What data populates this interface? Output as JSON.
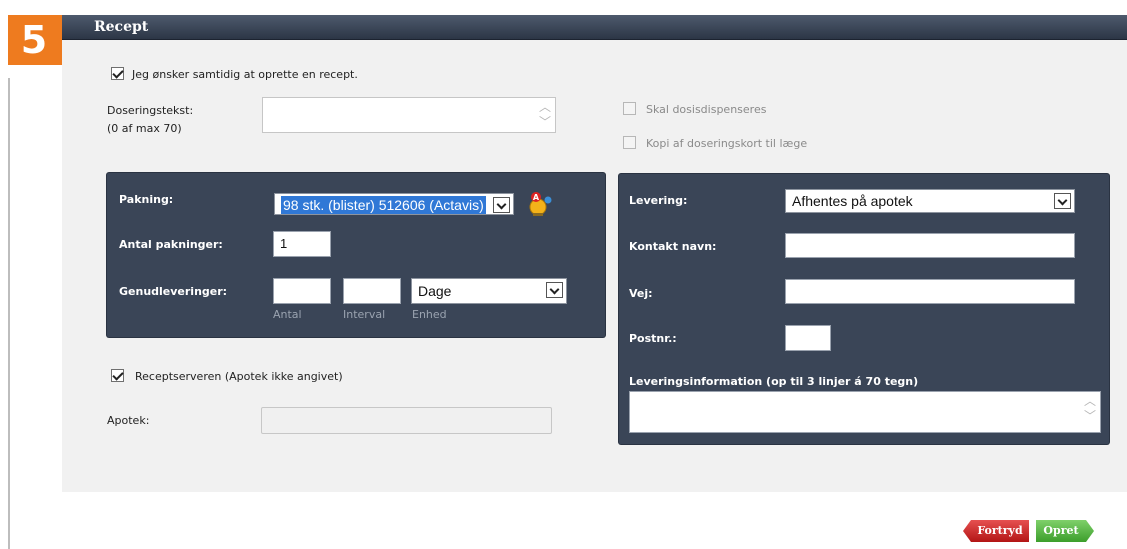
{
  "section": {
    "step_number": "5",
    "title": "Recept"
  },
  "form": {
    "create_recipe_label": "Jeg ønsker samtidig at oprette en recept.",
    "create_recipe_checked": true,
    "dosing_label": "Doseringstekst:",
    "dosing_counter": "(0 af max 70)",
    "dosing_value": "",
    "dose_dispense_label": "Skal dosisdispenseres",
    "copy_card_label": "Kopi af doseringskort til læge",
    "recipe_server_label": "Receptserveren (Apotek ikke angivet)",
    "recipe_server_checked": true,
    "pharmacy_label": "Apotek:",
    "pharmacy_value": ""
  },
  "package_panel": {
    "package_label": "Pakning:",
    "package_value": "98 stk. (blister) 512606 (Actavis)",
    "count_label": "Antal pakninger:",
    "count_value": "1",
    "refill_label": "Genudleveringer:",
    "refill_count_value": "",
    "refill_interval_value": "",
    "refill_unit_value": "Dage",
    "sub_count": "Antal",
    "sub_interval": "Interval",
    "sub_unit": "Enhed"
  },
  "delivery_panel": {
    "delivery_label": "Levering:",
    "delivery_value": "Afhentes på apotek",
    "contact_label": "Kontakt navn:",
    "contact_value": "",
    "street_label": "Vej:",
    "street_value": "",
    "postal_label": "Postnr.:",
    "postal_value": "",
    "info_label": "Leveringsinformation (op til 3 linjer á 70 tegn)",
    "info_value": ""
  },
  "buttons": {
    "cancel": "Fortryd",
    "create": "Opret"
  },
  "colors": {
    "accent_orange": "#ee7b1f",
    "panel_bg": "#3a4557",
    "header_bg": "#3b4658",
    "cancel_red": "#c62020",
    "create_green": "#55b642"
  }
}
